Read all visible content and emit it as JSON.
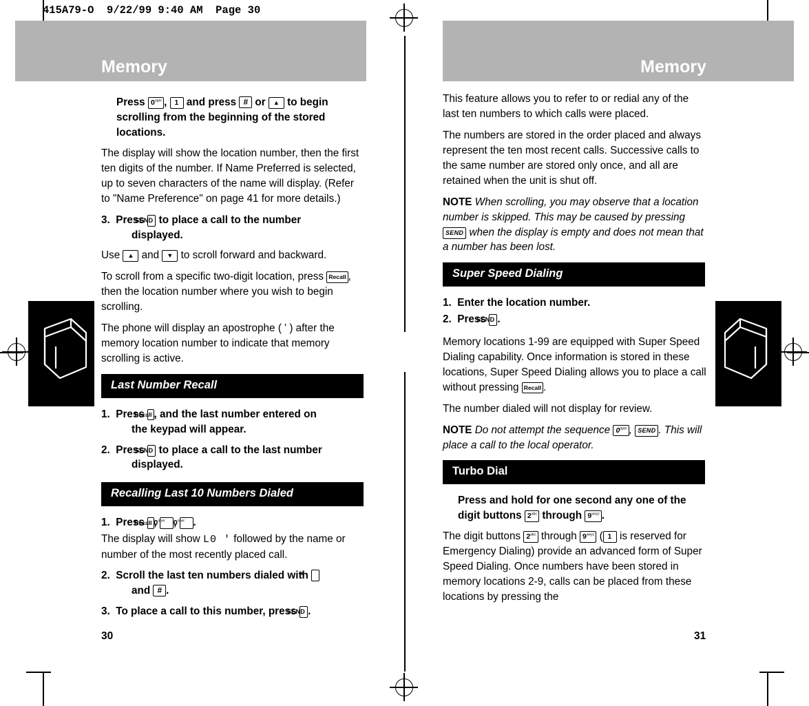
{
  "slug": "415A79-O  9/22/99 9:40 AM  Page 30",
  "pages": {
    "left": {
      "banner_title": "Memory",
      "page_number": "30",
      "blocks": [
        {
          "type": "instruction-bold",
          "text": "Press KEY_0, KEY_1 and press KEY_HASH or KEY_UP to begin scrolling from the beginning of the stored locations."
        },
        {
          "type": "paragraph",
          "text": "The display will show the location number, then the first ten digits of the number. If Name Preferred is selected, up to seven characters of the name will display. (Refer to \"Name Preference\" on page 41 for more details.)"
        },
        {
          "type": "numbered-bold",
          "number": "3.",
          "text": "Press KEY_SEND to place a call to the number displayed."
        },
        {
          "type": "paragraph",
          "text": "Use KEY_UP and KEY_DOWN to scroll forward and backward."
        },
        {
          "type": "paragraph",
          "text": "To scroll from a specific two-digit location, press KEY_RECALL, then the location number where you wish to begin scrolling."
        },
        {
          "type": "paragraph",
          "text": "The phone will display an apostrophe ( ' ) after the memory location number to indicate that memory scrolling is active."
        },
        {
          "type": "section-bar",
          "text": "Last Number Recall"
        },
        {
          "type": "numbered-bold",
          "number": "1.",
          "text": "Press KEY_RECALL, and the last number entered on the keypad will appear."
        },
        {
          "type": "numbered-bold",
          "number": "2.",
          "text": "Press KEY_SEND to place a call to the last number displayed."
        },
        {
          "type": "section-bar",
          "text": "Recalling Last 10 Numbers Dialed"
        },
        {
          "type": "numbered-bold",
          "number": "1.",
          "text": "Press KEY_RECALL, KEY_0, KEY_0."
        },
        {
          "type": "paragraph",
          "text": "The display will show L0 ' followed by the name or number of the most recently placed call."
        },
        {
          "type": "numbered-bold",
          "number": "2.",
          "text": "Scroll the last ten numbers dialed with KEY_STAR and KEY_HASH."
        },
        {
          "type": "numbered-bold",
          "number": "3.",
          "text": "To place a call to this number, press KEY_SEND."
        }
      ]
    },
    "right": {
      "banner_title": "Memory",
      "page_number": "31",
      "blocks": [
        {
          "type": "paragraph",
          "text": "This feature allows you to refer to or redial any of the last ten numbers to which calls were placed."
        },
        {
          "type": "paragraph",
          "text": "The numbers are stored in the order placed and always represent the ten most recent calls. Successive calls to the same number are stored only once, and all are retained when the unit is shut off."
        },
        {
          "type": "note",
          "label": "NOTE",
          "text": "When scrolling, you may observe that a location number is skipped. This may be caused by pressing KEY_SEND when the display is empty and does not mean that a number has been lost."
        },
        {
          "type": "section-bar",
          "text": "Super Speed Dialing"
        },
        {
          "type": "numbered-bold",
          "number": "1.",
          "text": "Enter the location number."
        },
        {
          "type": "numbered-bold",
          "number": "2.",
          "text": "Press KEY_SEND."
        },
        {
          "type": "paragraph",
          "text": "Memory locations 1-99 are equipped with Super Speed Dialing capability. Once information is stored in these locations, Super Speed Dialing allows you to place a call without pressing KEY_RECALL."
        },
        {
          "type": "paragraph",
          "text": "The number dialed will not display for review."
        },
        {
          "type": "note",
          "label": "NOTE",
          "text": "Do not attempt the sequence KEY_0, KEY_SEND. This will place a call to the local operator."
        },
        {
          "type": "section-bar",
          "text": "Turbo Dial"
        },
        {
          "type": "instruction-bold",
          "text": "Press and hold for one second any one of the digit buttons KEY_2 through KEY_9."
        },
        {
          "type": "paragraph",
          "text": "The digit buttons KEY_2 through KEY_9 (KEY_1 is reserved for Emergency Dialing) provide an advanced form of Super Speed Dialing. Once numbers have been stored in memory locations 2-9, calls can be placed from these locations by pressing the"
        }
      ]
    }
  },
  "keys": {
    "send": "SEND",
    "recall": "Recall",
    "hash": "#",
    "star": "*",
    "up": "▲",
    "down": "▼",
    "zero": "0",
    "zero_sup": "oper",
    "one": "1",
    "two": "2",
    "two_sup": "abc",
    "nine": "9",
    "nine_sup": "wxyz"
  },
  "lcd": {
    "last_dialed": "L0 '"
  },
  "colors": {
    "banner": "#b3b3b3",
    "section_bar": "#000000",
    "section_text": "#ffffff",
    "page_bg": "#ffffff",
    "text": "#000000"
  }
}
